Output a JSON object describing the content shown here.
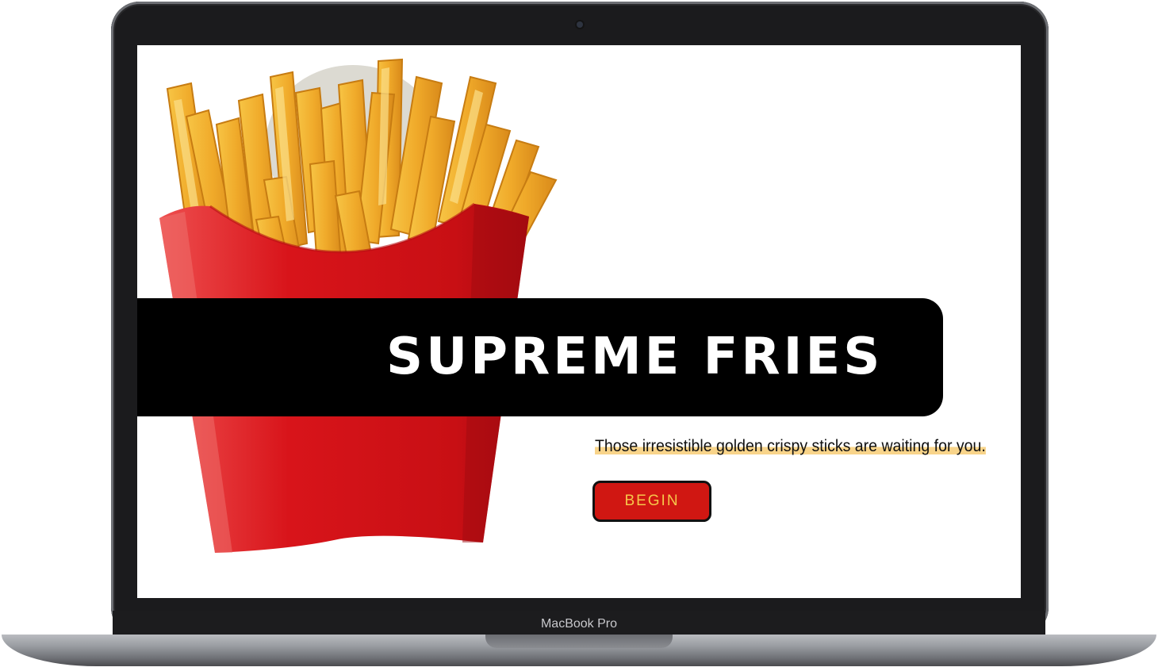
{
  "device": {
    "brand_label": "MacBook Pro"
  },
  "hero": {
    "title": "SUPREME FRIES",
    "tagline": "Those irresistible golden crispy sticks are waiting for you.",
    "cta_label": "BEGIN"
  },
  "colors": {
    "band": "#000000",
    "button": "#d01712",
    "button_text": "#f6c64a",
    "highlight": "#f8d48a",
    "fries_box": "#d8141a",
    "fries": "#f2b335"
  },
  "icons": {
    "camera": "camera-dot-icon"
  }
}
